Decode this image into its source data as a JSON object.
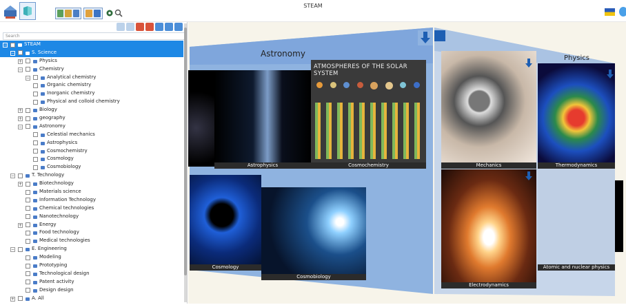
{
  "app": {
    "title": "STEAM"
  },
  "search": {
    "placeholder": "Search"
  },
  "tree": [
    {
      "label": "STEAM",
      "level": 0,
      "expanded": true,
      "checkbox": true,
      "selected": true
    },
    {
      "label": "S. Science",
      "level": 1,
      "expanded": true,
      "checkbox": true,
      "selected": true
    },
    {
      "label": "Physics",
      "level": 2,
      "expanded": false,
      "checkbox": true
    },
    {
      "label": "Chemistry",
      "level": 2,
      "expanded": true,
      "checkbox": true
    },
    {
      "label": "Analytical chemistry",
      "level": 3,
      "expanded": true,
      "checkbox": true
    },
    {
      "label": "Organic chemistry",
      "level": 3,
      "checkbox": true
    },
    {
      "label": "Inorganic chemistry",
      "level": 3,
      "checkbox": true
    },
    {
      "label": "Physical and colloid chemistry",
      "level": 3,
      "checkbox": true
    },
    {
      "label": "Biology",
      "level": 2,
      "expanded": false,
      "checkbox": true
    },
    {
      "label": "geography",
      "level": 2,
      "expanded": false,
      "checkbox": true
    },
    {
      "label": "Astronomy",
      "level": 2,
      "expanded": true,
      "checkbox": true
    },
    {
      "label": "Celestial mechanics",
      "level": 3,
      "checkbox": true
    },
    {
      "label": "Astrophysics",
      "level": 3,
      "checkbox": true
    },
    {
      "label": "Cosmochemistry",
      "level": 3,
      "checkbox": true
    },
    {
      "label": "Cosmology",
      "level": 3,
      "checkbox": true
    },
    {
      "label": "Cosmobiology",
      "level": 3,
      "checkbox": true
    },
    {
      "label": "T. Technology",
      "level": 1,
      "expanded": true,
      "checkbox": true
    },
    {
      "label": "Biotechnology",
      "level": 2,
      "expanded": false,
      "checkbox": true
    },
    {
      "label": "Materials science",
      "level": 2,
      "checkbox": true
    },
    {
      "label": "Information Technology",
      "level": 2,
      "checkbox": true
    },
    {
      "label": "Chemical technologies",
      "level": 2,
      "checkbox": true
    },
    {
      "label": "Nanotechnology",
      "level": 2,
      "checkbox": true
    },
    {
      "label": "Energy",
      "level": 2,
      "expanded": false,
      "checkbox": true
    },
    {
      "label": "Food technology",
      "level": 2,
      "checkbox": true
    },
    {
      "label": "Medical technologies",
      "level": 2,
      "checkbox": true
    },
    {
      "label": "E. Engineering",
      "level": 1,
      "expanded": true,
      "checkbox": true
    },
    {
      "label": "Modeling",
      "level": 2,
      "checkbox": true
    },
    {
      "label": "Prototyping",
      "level": 2,
      "checkbox": true
    },
    {
      "label": "Technological design",
      "level": 2,
      "checkbox": true
    },
    {
      "label": "Patent activity",
      "level": 2,
      "checkbox": true
    },
    {
      "label": "Design design",
      "level": 2,
      "checkbox": true
    },
    {
      "label": "A. All",
      "level": 1,
      "expanded": false,
      "checkbox": true
    }
  ],
  "cube": {
    "left_face_title": "Astronomy",
    "right_face_title": "Physics",
    "left_cards": [
      "Astrophysics",
      "Cosmochemistry",
      "Cosmology",
      "Cosmobiology"
    ],
    "right_cards": [
      "Mechanics",
      "Thermodynamics",
      "Electrodynamics",
      "Atomic and nuclear physics"
    ],
    "poster_title": "ATMOSPHERES OF THE SOLAR SYSTEM",
    "face_color": "#8fb3e0"
  },
  "colors": {
    "accent": "#1e88e5",
    "card_caption": "#2b2b2b"
  }
}
